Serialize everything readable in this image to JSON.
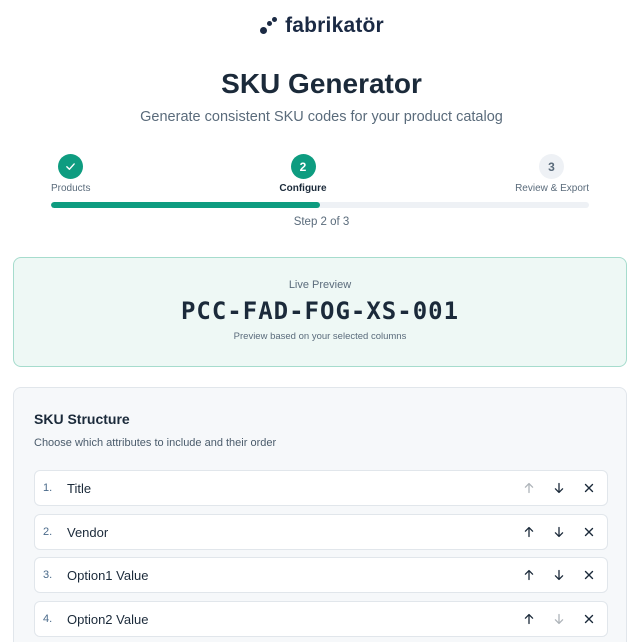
{
  "brand": {
    "name": "fabrikatör"
  },
  "header": {
    "title": "SKU Generator",
    "subtitle": "Generate consistent SKU codes for your product catalog"
  },
  "stepper": {
    "steps": [
      {
        "number": "1",
        "label": "Products",
        "state": "done"
      },
      {
        "number": "2",
        "label": "Configure",
        "state": "active"
      },
      {
        "number": "3",
        "label": "Review & Export",
        "state": "todo"
      }
    ],
    "progress_percent": 50,
    "status_text": "Step 2 of 3"
  },
  "preview": {
    "label": "Live Preview",
    "code": "PCC-FAD-FOG-XS-001",
    "note": "Preview based on your selected columns"
  },
  "structure": {
    "title": "SKU Structure",
    "description": "Choose which attributes to include and their order",
    "items": [
      {
        "index": "1.",
        "label": "Title",
        "can_move_up": false,
        "can_move_down": true
      },
      {
        "index": "2.",
        "label": "Vendor",
        "can_move_up": true,
        "can_move_down": true
      },
      {
        "index": "3.",
        "label": "Option1 Value",
        "can_move_up": true,
        "can_move_down": true
      },
      {
        "index": "4.",
        "label": "Option2 Value",
        "can_move_up": true,
        "can_move_down": false
      }
    ]
  },
  "colors": {
    "accent": "#0e9c80",
    "brand": "#1b2a44",
    "preview_bg": "#eef8f5",
    "preview_border": "#a6dccd"
  },
  "icons": {
    "check": "check-icon",
    "up": "arrow-up-icon",
    "down": "arrow-down-icon",
    "remove": "close-icon"
  }
}
